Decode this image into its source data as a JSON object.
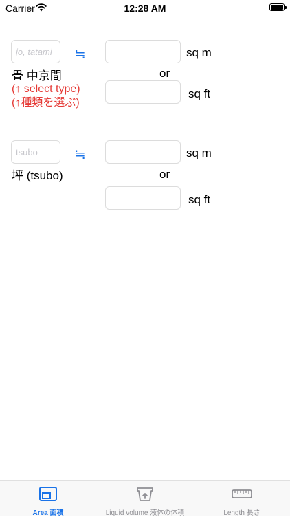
{
  "status_bar": {
    "carrier": "Carrier",
    "time": "12:28 AM"
  },
  "jo_section": {
    "input_placeholder": "jo, tatami",
    "approx_symbol": "≒",
    "label": "畳 中京間",
    "hint_line1": "(↑ select type)",
    "hint_line2": "(↑種類を選ぶ)",
    "unit_sqm": "sq m",
    "or": "or",
    "unit_sqft": "sq ft"
  },
  "tsubo_section": {
    "input_placeholder": "tsubo",
    "approx_symbol": "≒",
    "label": "坪 (tsubo)",
    "unit_sqm": "sq m",
    "or": "or",
    "unit_sqft": "sq ft"
  },
  "tab_bar": {
    "tabs": [
      {
        "label": "Area 面積",
        "icon": "area-icon",
        "active": true
      },
      {
        "label": "Liquid volume 液体の体積",
        "icon": "liquid-volume-icon",
        "active": false
      },
      {
        "label": "Length 長さ",
        "icon": "ruler-icon",
        "active": false
      }
    ]
  },
  "colors": {
    "accent": "#1a73e8",
    "hint": "#e53935",
    "inactive": "#8e8e93"
  }
}
